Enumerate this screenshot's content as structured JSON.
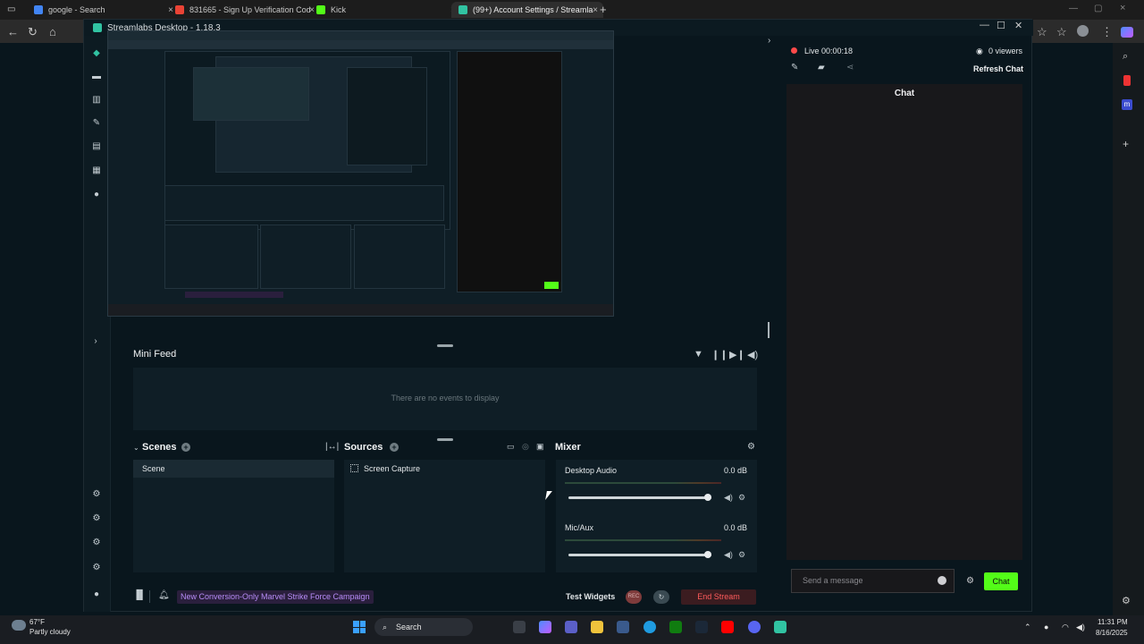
{
  "browser": {
    "tabs": [
      {
        "label": "google - Search",
        "color": "#4285f4"
      },
      {
        "label": "831665 - Sign Up Verification Cod",
        "color": "#ea4335"
      },
      {
        "label": "Kick",
        "color": "#53fc18"
      },
      {
        "label": "(99+) Account Settings / Streamla",
        "color": "#31c3a2"
      }
    ]
  },
  "window": {
    "title": "Streamlabs Desktop - 1.18.3"
  },
  "mini_feed": {
    "title": "Mini Feed",
    "empty_text": "There are no events to display"
  },
  "scenes": {
    "title": "Scenes",
    "items": [
      "Scene"
    ]
  },
  "sources": {
    "title": "Sources",
    "items": [
      "Screen Capture"
    ]
  },
  "mixer": {
    "title": "Mixer",
    "channels": [
      {
        "label": "Desktop Audio",
        "db": "0.0 dB",
        "volume": 1.0
      },
      {
        "label": "Mic/Aux",
        "db": "0.0 dB",
        "volume": 1.0
      }
    ]
  },
  "footer": {
    "campaign": "New Conversion-Only Marvel Strike Force Campaign",
    "test_widgets": "Test Widgets",
    "rec_label": "REC",
    "end_stream": "End Stream"
  },
  "chat_panel": {
    "live_label": "Live 00:00:18",
    "viewers_label": "0 viewers",
    "refresh_label": "Refresh Chat",
    "header": "Chat",
    "input_placeholder": "Send a message",
    "send_label": "Chat",
    "send_color": "#53fc18"
  },
  "taskbar": {
    "weather_temp": "67°F",
    "weather_desc": "Partly cloudy",
    "search_label": "Search",
    "time": "11:31 PM",
    "date": "8/16/2025"
  }
}
